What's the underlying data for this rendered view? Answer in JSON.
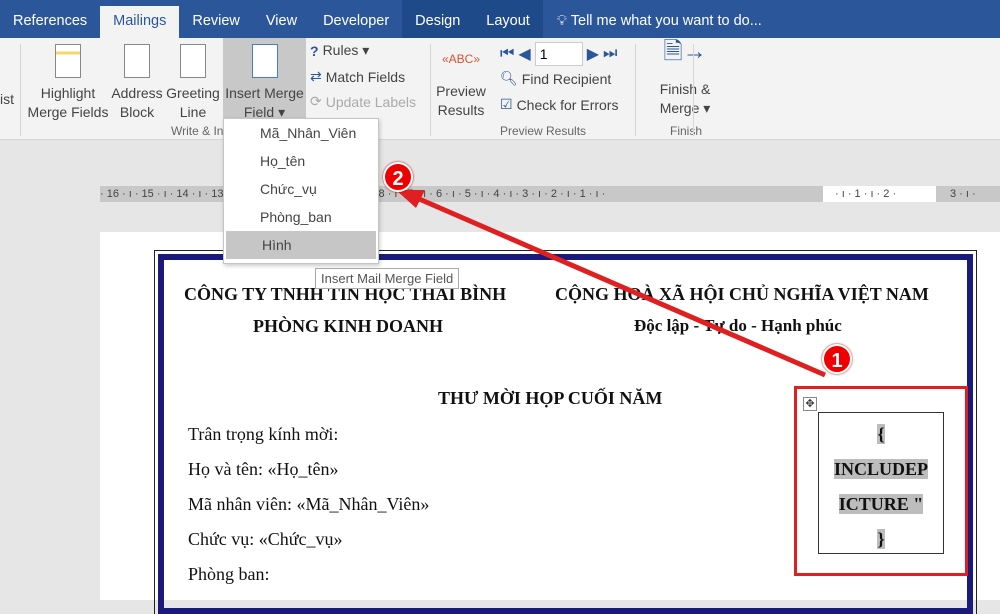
{
  "tabs": [
    "References",
    "Mailings",
    "Review",
    "View",
    "Developer",
    "Design",
    "Layout"
  ],
  "tell_me": "Tell me what you want to do...",
  "ribbon": {
    "partial": "ist",
    "highlight": [
      "Highlight",
      "Merge Fields"
    ],
    "address": [
      "Address",
      "Block"
    ],
    "greeting": [
      "Greeting",
      "Line"
    ],
    "insert": [
      "Insert Merge",
      "Field ▾"
    ],
    "rules": "Rules ▾",
    "match": "Match Fields",
    "update": "Update Labels",
    "group_write": "Write & In",
    "preview": [
      "Preview",
      "Results"
    ],
    "record": "1",
    "find": "Find Recipient",
    "check": "Check for Errors",
    "group_preview": "Preview Results",
    "finish": [
      "Finish &",
      "Merge ▾"
    ],
    "group_finish": "Finish"
  },
  "menu": {
    "items": [
      "Mã_Nhân_Viên",
      "Họ_tên",
      "Chức_vụ",
      "Phòng_ban",
      "Hình"
    ],
    "tooltip": "Insert Mail Merge Field"
  },
  "ruler": "· 16 · ı · 15 · ı · 14 · ı · 13 · ı · 12 · ı · 11 · ı · 10 · ı · 9 · ı · 8 · ı · 7 · ı · 6 · ı · 5 · ı · 4 · ı · 3 · ı · 2 · ı · 1 · ı ·",
  "ruler_right": "· ı · 1 · ı · 2 ·",
  "ruler_end": "3 · ı ·",
  "doc": {
    "company": "CÔNG TY TNHH TIN HỌC THÁI BÌNH",
    "dept": "PHÒNG KINH DOANH",
    "nation": "CỘNG HOÀ XÃ HỘI CHỦ NGHĨA VIỆT NAM",
    "motto": "Độc lập - Tự do - Hạnh phúc",
    "title": "THƯ MỜI HỌP CUỐI NĂM",
    "lines": [
      "Trân trọng kính mời:",
      "Họ và tên: «Họ_tên»",
      "Mã nhân viên: «Mã_Nhân_Viên»",
      "Chức vụ: «Chức_vụ»",
      "Phòng ban:"
    ],
    "field": [
      "{",
      "INCLUDEP",
      "ICTURE \"",
      "}"
    ]
  },
  "badges": [
    "1",
    "2"
  ]
}
